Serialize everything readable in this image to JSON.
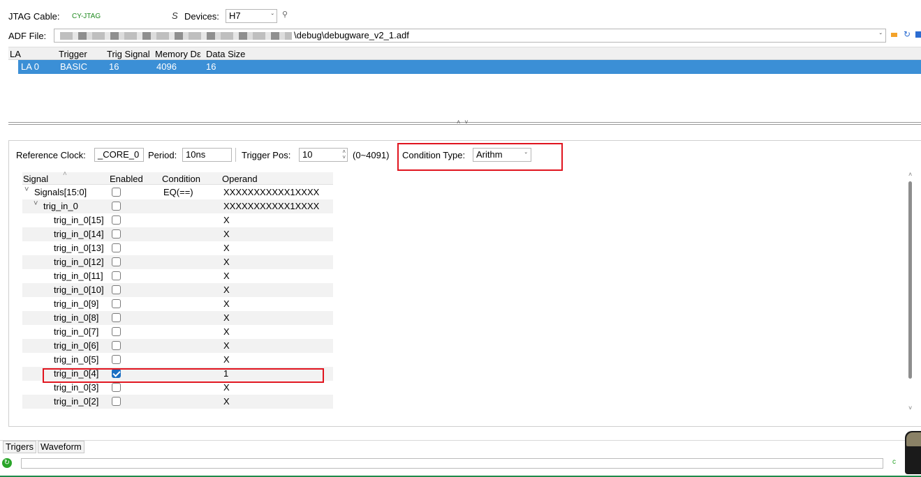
{
  "top": {
    "jtag_label": "JTAG Cable:",
    "jtag_value": "CY-JTAG",
    "devices_label": "Devices:",
    "devices_value": "H7",
    "adf_label": "ADF File:",
    "adf_value": "\\debug\\debugware_v2_1.adf"
  },
  "la_table": {
    "headers": [
      "LA",
      "Trigger",
      "Trig Signal",
      "Memory Dε",
      "Data Size"
    ],
    "rows": [
      {
        "la": "LA 0",
        "trigger": "BASIC",
        "trig_signal": "16",
        "memory": "4096",
        "data_size": "16"
      }
    ]
  },
  "config": {
    "ref_clock_label": "Reference Clock:",
    "ref_clock_value": "_CORE_0",
    "period_label": "Period:",
    "period_value": "10ns",
    "trigger_pos_label": "Trigger Pos:",
    "trigger_pos_value": "10",
    "trigger_pos_range": "(0~4091)",
    "condition_type_label": "Condition Type:",
    "condition_type_value": "Arithm"
  },
  "signal_table": {
    "headers": {
      "signal": "Signal",
      "enabled": "Enabled",
      "condition": "Condition",
      "operand": "Operand"
    },
    "rows": [
      {
        "name": "Signals[15:0]",
        "indent": 0,
        "expander": "˅",
        "enabled": false,
        "condition": "EQ(==)",
        "operand": "XXXXXXXXXXX1XXXX",
        "highlight": false
      },
      {
        "name": "trig_in_0",
        "indent": 1,
        "expander": "˅",
        "enabled": false,
        "condition": "",
        "operand": "XXXXXXXXXXX1XXXX",
        "highlight": false
      },
      {
        "name": "trig_in_0[15]",
        "indent": 2,
        "expander": "",
        "enabled": false,
        "condition": "",
        "operand": "X",
        "highlight": false
      },
      {
        "name": "trig_in_0[14]",
        "indent": 2,
        "expander": "",
        "enabled": false,
        "condition": "",
        "operand": "X",
        "highlight": false
      },
      {
        "name": "trig_in_0[13]",
        "indent": 2,
        "expander": "",
        "enabled": false,
        "condition": "",
        "operand": "X",
        "highlight": false
      },
      {
        "name": "trig_in_0[12]",
        "indent": 2,
        "expander": "",
        "enabled": false,
        "condition": "",
        "operand": "X",
        "highlight": false
      },
      {
        "name": "trig_in_0[11]",
        "indent": 2,
        "expander": "",
        "enabled": false,
        "condition": "",
        "operand": "X",
        "highlight": false
      },
      {
        "name": "trig_in_0[10]",
        "indent": 2,
        "expander": "",
        "enabled": false,
        "condition": "",
        "operand": "X",
        "highlight": false
      },
      {
        "name": "trig_in_0[9]",
        "indent": 2,
        "expander": "",
        "enabled": false,
        "condition": "",
        "operand": "X",
        "highlight": false
      },
      {
        "name": "trig_in_0[8]",
        "indent": 2,
        "expander": "",
        "enabled": false,
        "condition": "",
        "operand": "X",
        "highlight": false
      },
      {
        "name": "trig_in_0[7]",
        "indent": 2,
        "expander": "",
        "enabled": false,
        "condition": "",
        "operand": "X",
        "highlight": false
      },
      {
        "name": "trig_in_0[6]",
        "indent": 2,
        "expander": "",
        "enabled": false,
        "condition": "",
        "operand": "X",
        "highlight": false
      },
      {
        "name": "trig_in_0[5]",
        "indent": 2,
        "expander": "",
        "enabled": false,
        "condition": "",
        "operand": "X",
        "highlight": false
      },
      {
        "name": "trig_in_0[4]",
        "indent": 2,
        "expander": "",
        "enabled": true,
        "condition": "",
        "operand": "1",
        "highlight": true
      },
      {
        "name": "trig_in_0[3]",
        "indent": 2,
        "expander": "",
        "enabled": false,
        "condition": "",
        "operand": "X",
        "highlight": false
      },
      {
        "name": "trig_in_0[2]",
        "indent": 2,
        "expander": "",
        "enabled": false,
        "condition": "",
        "operand": "X",
        "highlight": false
      }
    ]
  },
  "bottom_tabs": [
    "Trigers",
    "Waveform"
  ],
  "colors": {
    "selection": "#3b8fd6",
    "annotation_red": "#e0141e",
    "checkbox_blue": "#1b6ec2",
    "jtag_green": "#1f8a1f"
  }
}
